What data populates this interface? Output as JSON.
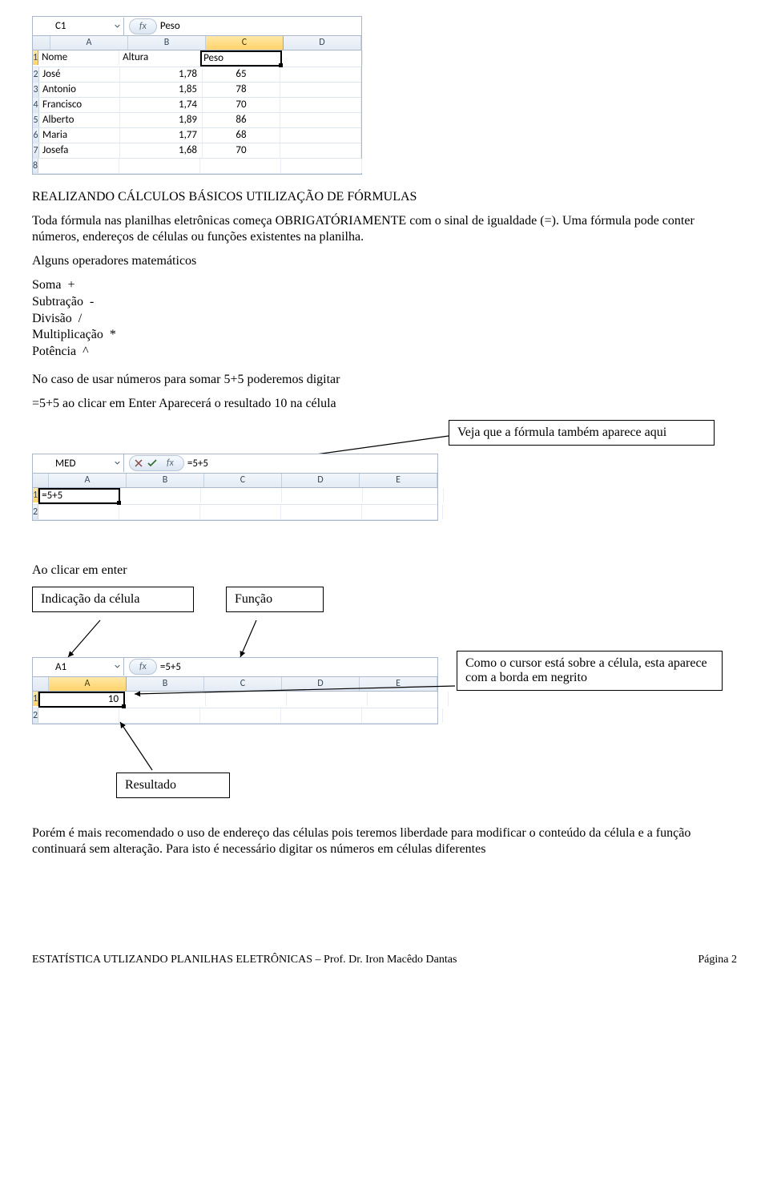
{
  "sheet1": {
    "namebox": "C1",
    "fbar_value": "Peso",
    "cols": [
      "A",
      "B",
      "C",
      "D"
    ],
    "rows": [
      {
        "n": "1",
        "a": "Nome",
        "b": "Altura",
        "c": "Peso",
        "d": ""
      },
      {
        "n": "2",
        "a": "José",
        "b": "1,78",
        "c": "65",
        "d": ""
      },
      {
        "n": "3",
        "a": "Antonio",
        "b": "1,85",
        "c": "78",
        "d": ""
      },
      {
        "n": "4",
        "a": "Francisco",
        "b": "1,74",
        "c": "70",
        "d": ""
      },
      {
        "n": "5",
        "a": "Alberto",
        "b": "1,89",
        "c": "86",
        "d": ""
      },
      {
        "n": "6",
        "a": "Maria",
        "b": "1,77",
        "c": "68",
        "d": ""
      },
      {
        "n": "7",
        "a": "Josefa",
        "b": "1,68",
        "c": "70",
        "d": ""
      },
      {
        "n": "8",
        "a": "",
        "b": "",
        "c": "",
        "d": ""
      }
    ]
  },
  "title1": "REALIZANDO CÁLCULOS BÁSICOS UTILIZAÇÃO DE FÓRMULAS",
  "para1": "Toda fórmula nas planilhas eletrônicas começa OBRIGATÓRIAMENTE com o sinal de igualdade (=). Uma fórmula pode conter números, endereços de células ou funções existentes na planilha.",
  "ops_title": "Alguns operadores matemáticos",
  "ops": [
    {
      "name": "Soma",
      "sym": "+"
    },
    {
      "name": "Subtração",
      "sym": "-"
    },
    {
      "name": "Divisão",
      "sym": "/"
    },
    {
      "name": "Multiplicação",
      "sym": "*"
    },
    {
      "name": "Potência",
      "sym": "^"
    }
  ],
  "para2": "No caso de usar números para somar 5+5 poderemos digitar",
  "para3": "=5+5 ao clicar em Enter Aparecerá o resultado 10 na célula",
  "annot1": "Veja que a fórmula também aparece aqui",
  "sheet2": {
    "namebox": "MED",
    "fbar_value": "=5+5",
    "cols": [
      "A",
      "B",
      "C",
      "D",
      "E"
    ],
    "rows": [
      {
        "n": "1",
        "a": "=5+5"
      },
      {
        "n": "2",
        "a": ""
      }
    ]
  },
  "para4": "Ao clicar em enter",
  "annot2a": "Indicação da célula",
  "annot2b": "Função",
  "annot3": "Como o cursor está sobre a célula, esta aparece com a borda em negrito",
  "annot4": "Resultado",
  "sheet3": {
    "namebox": "A1",
    "fbar_value": "=5+5",
    "cols": [
      "A",
      "B",
      "C",
      "D",
      "E"
    ],
    "rows": [
      {
        "n": "1",
        "a": "10"
      },
      {
        "n": "2",
        "a": ""
      }
    ]
  },
  "para5": "Porém é mais recomendado o uso de endereço das células pois teremos liberdade para modificar o conteúdo da célula e a função continuará sem alteração. Para isto é necessário digitar os números em células diferentes",
  "footer_left": "ESTATÍSTICA UTLIZANDO PLANILHAS ELETRÔNICAS – Prof. Dr. Iron Macêdo Dantas",
  "footer_right": "Página 2",
  "fx_label": "fx"
}
